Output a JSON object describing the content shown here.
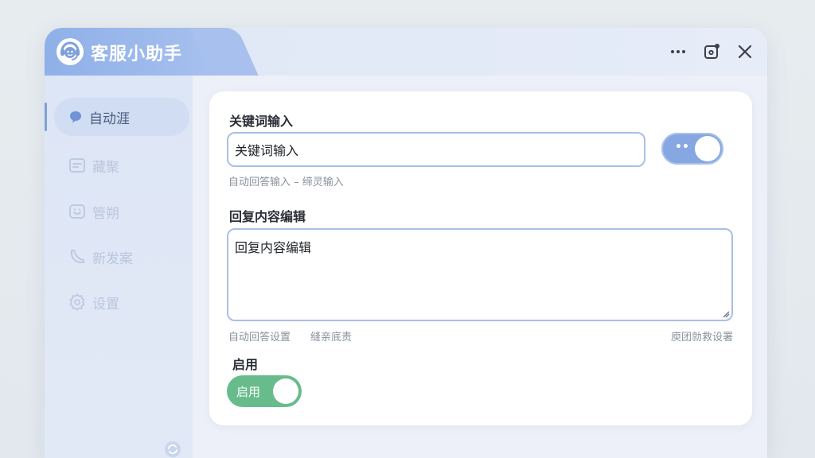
{
  "app": {
    "title": "客服小助手"
  },
  "sidebar": {
    "items": [
      {
        "label": "自动涯",
        "icon": "chat-bubble-icon",
        "active": true
      },
      {
        "label": "藏聚",
        "icon": "note-icon",
        "active": false
      },
      {
        "label": "管朔",
        "icon": "smile-box-icon",
        "active": false
      },
      {
        "label": "新发案",
        "icon": "leaf-icon",
        "active": false
      },
      {
        "label": "设置",
        "icon": "gear-icon",
        "active": false
      }
    ]
  },
  "form": {
    "keyword_label": "关键词输入",
    "keyword_value": "关键词输入",
    "keyword_hint": "自动回答输入 – 缔灵输入",
    "toggle_dots": "••",
    "reply_label": "回复内容编辑",
    "reply_value": "回复内容编辑",
    "reply_hint_left": "自动回答设置",
    "reply_hint_mid": "缝亲底责",
    "reply_hint_right": "庾团勍救设署",
    "enable_label": "启用",
    "enable_toggle_text": "启用"
  },
  "colors": {
    "accent_blue": "#86a7e2",
    "accent_green": "#68bc8c"
  }
}
